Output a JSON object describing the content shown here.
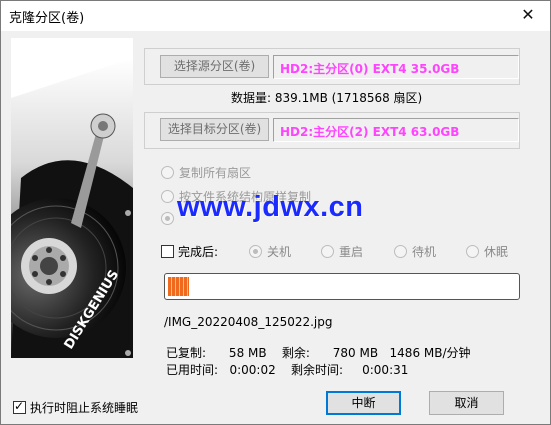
{
  "window": {
    "title": "克隆分区(卷)",
    "close_glyph": "✕"
  },
  "source": {
    "button_label": "选择源分区(卷)",
    "value": "HD2:主分区(0) EXT4 35.0GB"
  },
  "data_amount": "数据量: 839.1MB (1718568 扇区)",
  "target": {
    "button_label": "选择目标分区(卷)",
    "value": "HD2:主分区(2) EXT4 63.0GB"
  },
  "copy_modes": [
    {
      "label": "复制所有扇区",
      "checked": false
    },
    {
      "label": "按文件系统结构原样复制",
      "checked": false
    },
    {
      "label": "",
      "checked": true
    }
  ],
  "watermark": "www.jdwx.cn",
  "after_complete": {
    "label": "完成后:",
    "checked": false,
    "options": [
      {
        "label": "关机",
        "checked": true
      },
      {
        "label": "重启",
        "checked": false
      },
      {
        "label": "待机",
        "checked": false
      },
      {
        "label": "休眠",
        "checked": false
      }
    ]
  },
  "progress": {
    "fraction": 0.06
  },
  "current_file": "/IMG_20220408_125022.jpg",
  "stats": {
    "line1": "已复制:      58 MB    剩余:      780 MB   1486 MB/分钟",
    "line2": "已用时间:   0:00:02    剩余时间:     0:00:31"
  },
  "prevent_sleep": {
    "label": "执行时阻止系统睡眠",
    "checked": true
  },
  "buttons": {
    "stop": "中断",
    "cancel": "取消"
  },
  "side_image": {
    "brand_text": "DISKGENIUS"
  }
}
